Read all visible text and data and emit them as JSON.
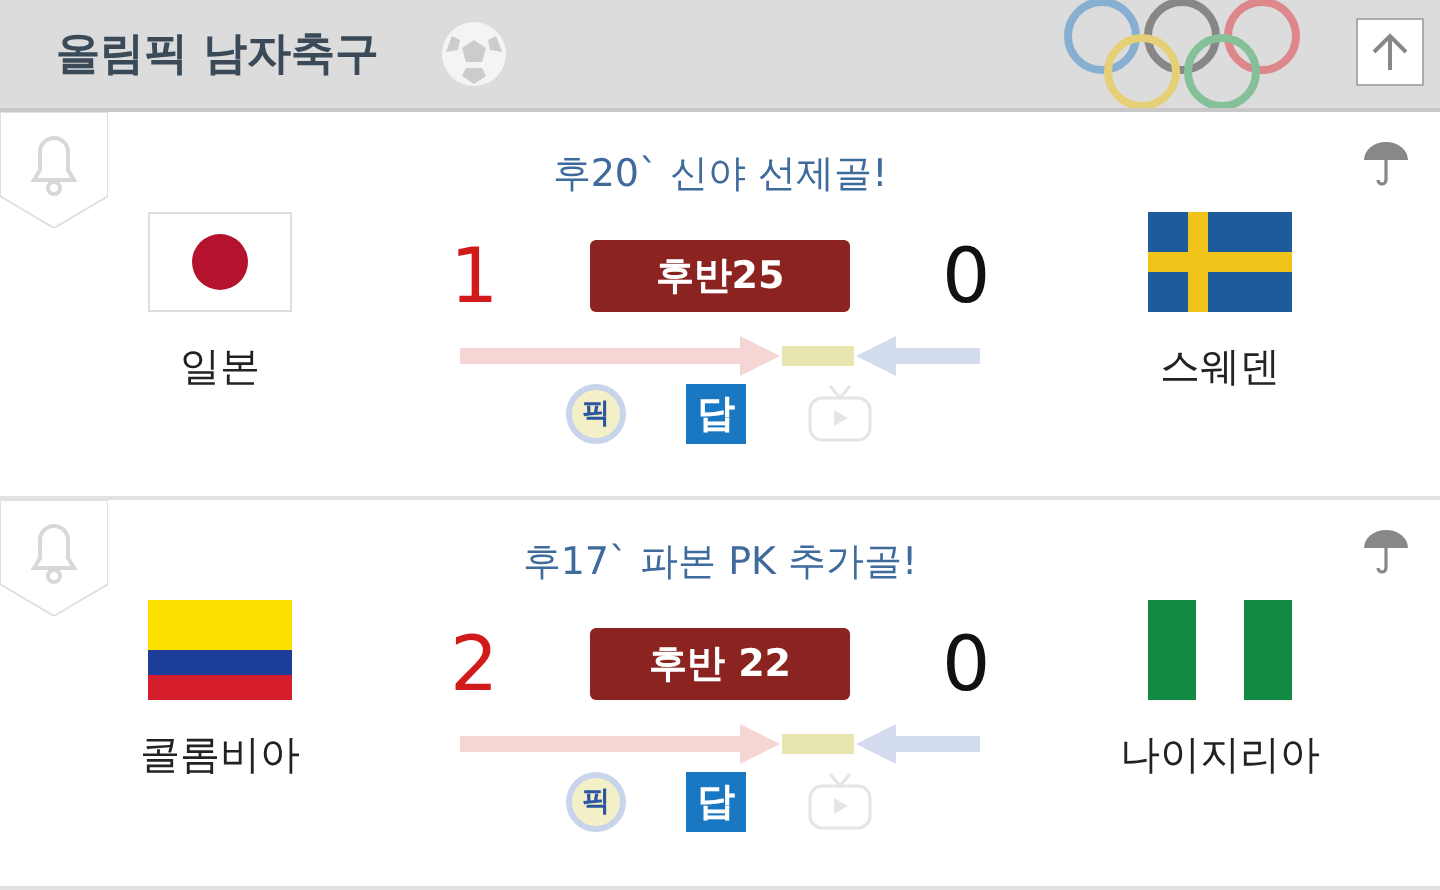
{
  "header": {
    "title": "올림픽 남자축구"
  },
  "matches": [
    {
      "headline": "후20` 신야 선제골!",
      "status": "후반25",
      "home": {
        "name": "일본",
        "kind": "japan",
        "score": "1",
        "leading": true
      },
      "away": {
        "name": "스웨덴",
        "kind": "sweden",
        "score": "0",
        "leading": false
      },
      "pick_label": "픽",
      "answer_label": "답",
      "video_available": false
    },
    {
      "headline": "후17` 파본 PK 추가골!",
      "status": "후반 22",
      "home": {
        "name": "콜롬비아",
        "kind": "colombia",
        "score": "2",
        "leading": true
      },
      "away": {
        "name": "나이지리아",
        "kind": "nigeria",
        "score": "0",
        "leading": false
      },
      "pick_label": "픽",
      "answer_label": "답",
      "video_available": false
    }
  ]
}
